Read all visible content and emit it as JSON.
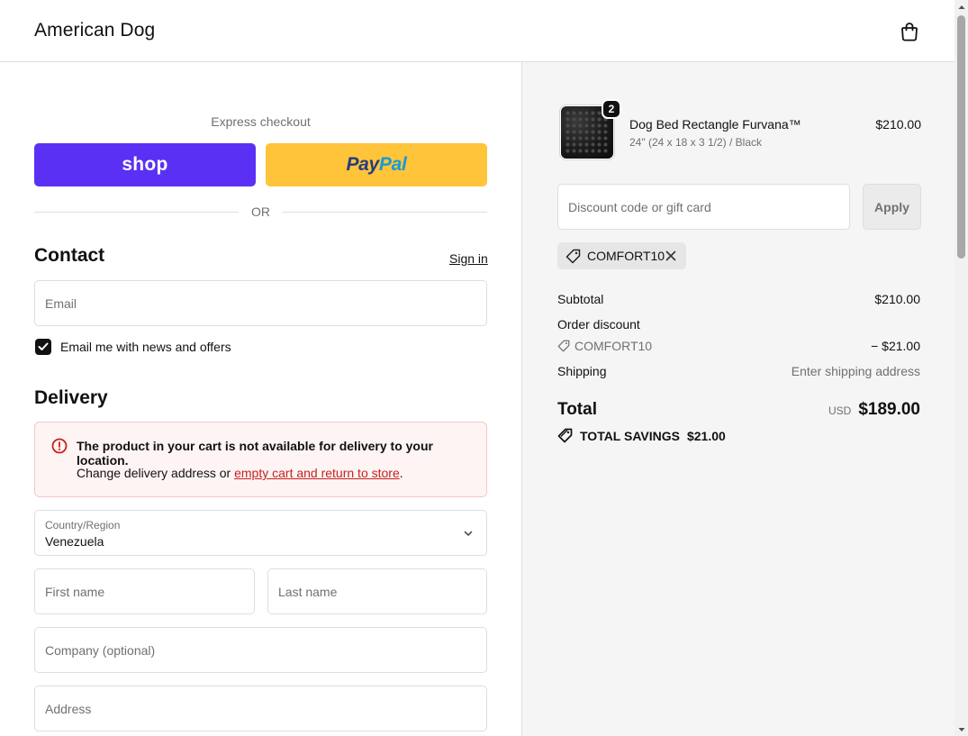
{
  "header": {
    "brand": "American Dog",
    "cart_icon": "shopping-bag-icon"
  },
  "express": {
    "title": "Express checkout",
    "shop_label": "shop",
    "paypal_pay": "Pay",
    "paypal_pal": "Pal",
    "or_label": "OR"
  },
  "contact": {
    "heading": "Contact",
    "sign_in": "Sign in",
    "email_placeholder": "Email",
    "news_label": "Email me with news and offers",
    "news_checked": true
  },
  "delivery": {
    "heading": "Delivery",
    "alert_title": "The product in your cart is not available for delivery to your location.",
    "alert_body_prefix": "Change delivery address or ",
    "alert_link": "empty cart and return to store",
    "alert_body_suffix": ".",
    "country_label": "Country/Region",
    "country_value": "Venezuela",
    "first_name_placeholder": "First name",
    "last_name_placeholder": "Last name",
    "company_placeholder": "Company (optional)",
    "address_placeholder": "Address"
  },
  "summary": {
    "product": {
      "name": "Dog Bed Rectangle Furvana™",
      "variant": "24\" (24 x 18 x 3 1/2) / Black",
      "price": "$210.00",
      "quantity": "2"
    },
    "discount_placeholder": "Discount code or gift card",
    "apply_label": "Apply",
    "applied_code": "COMFORT10",
    "subtotal_label": "Subtotal",
    "subtotal_value": "$210.00",
    "order_discount_label": "Order discount",
    "discount_code": "COMFORT10",
    "discount_value": "− $21.00",
    "shipping_label": "Shipping",
    "shipping_value": "Enter shipping address",
    "total_label": "Total",
    "currency": "USD",
    "total_value": "$189.00",
    "savings_label": "TOTAL SAVINGS",
    "savings_value": "$21.00"
  },
  "colors": {
    "shop_purple": "#5a31f4",
    "paypal_yellow": "#ffc439",
    "error_red": "#c5221f"
  }
}
